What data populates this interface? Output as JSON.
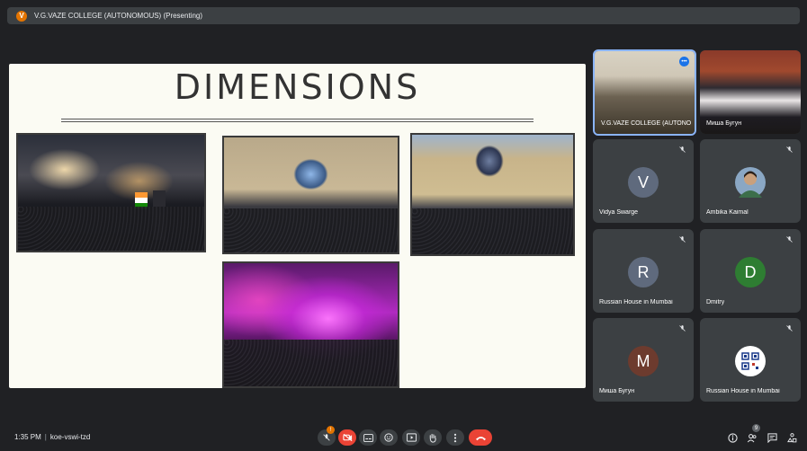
{
  "topbar": {
    "presenter_initial": "V",
    "title": "V.G.VAZE COLLEGE (AUTONOMOUS) (Presenting)"
  },
  "slide": {
    "title": "DIMENSIONS",
    "photos": [
      "concert-with-flag",
      "campus-courtyard-crowd",
      "campus-courtyard-stage",
      "pink-stage-concert"
    ]
  },
  "participants": [
    {
      "name": "V.G.VAZE COLLEGE (AUTONO...",
      "type": "video",
      "muted": false
    },
    {
      "name": "Миша Бугун",
      "type": "video",
      "muted": false
    },
    {
      "name": "Vidya Swarge",
      "type": "avatar",
      "initial": "V",
      "color": "#5f6a7d",
      "muted": true
    },
    {
      "name": "Ambika Kaimal",
      "type": "photo",
      "muted": true
    },
    {
      "name": "Russian House in Mumbai",
      "type": "avatar",
      "initial": "R",
      "color": "#5f6a7d",
      "muted": true
    },
    {
      "name": "Dmitry",
      "type": "avatar",
      "initial": "D",
      "color": "#2e7d32",
      "muted": true
    },
    {
      "name": "Миша Бугун",
      "type": "avatar",
      "initial": "M",
      "color": "#6d3b2e",
      "muted": true
    },
    {
      "name": "Russian House in Mumbai",
      "type": "logo",
      "muted": true
    }
  ],
  "bottombar": {
    "time": "1:35 PM",
    "meeting_code": "koe-vswi-tzd",
    "mic_badge": "!",
    "people_count": "9"
  },
  "colors": {
    "background": "#202124",
    "tile": "#3c4043",
    "hangup": "#ea4335",
    "active_border": "#8ab4f8"
  }
}
